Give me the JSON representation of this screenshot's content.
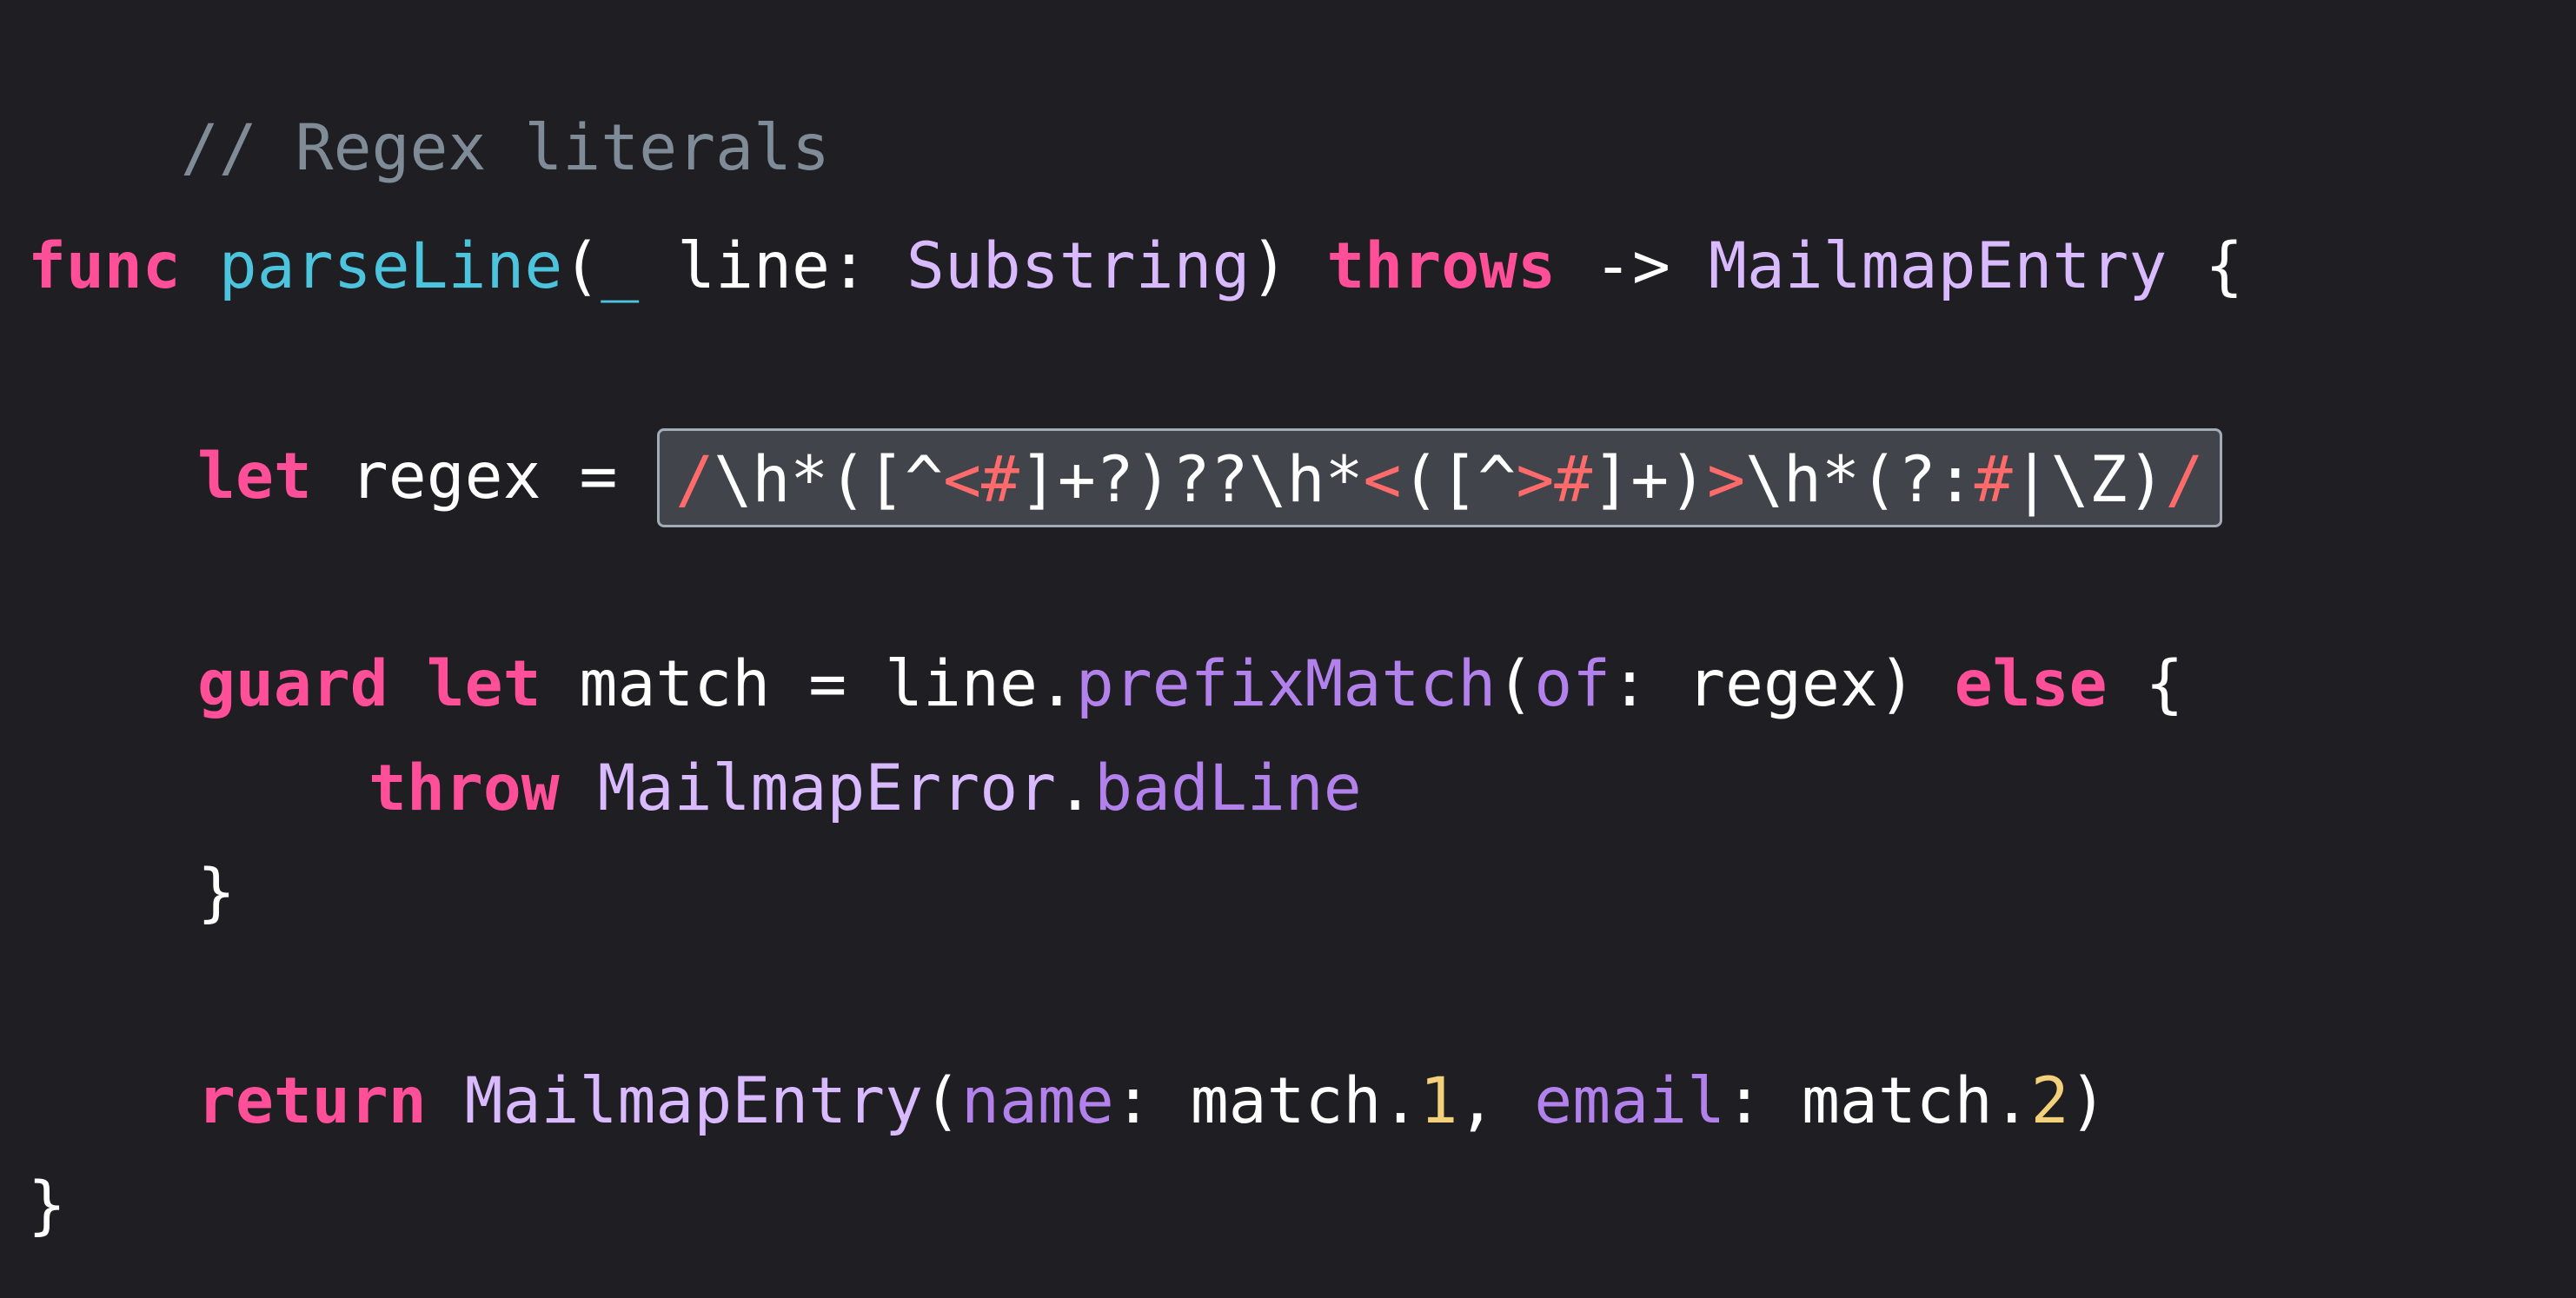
{
  "editor": {
    "lines": {
      "comment": "// Regex literals",
      "signature": {
        "kw_func": "func",
        "fn_name": "parseLine",
        "open_paren": "(",
        "underscore": "_",
        "param": " line: ",
        "param_type": "Substring",
        "close_paren": ") ",
        "kw_throws": "throws",
        "arrow": " -> ",
        "return_type": "MailmapEntry",
        "open_brace": " {"
      },
      "let_line": {
        "kw_let": "let",
        "rest": " regex = ",
        "regex": [
          {
            "text": "/",
            "kind": "delim"
          },
          {
            "text": "\\h*([^",
            "kind": "regex"
          },
          {
            "text": "<#",
            "kind": "delim"
          },
          {
            "text": "]+?)??\\h*",
            "kind": "regex"
          },
          {
            "text": "<",
            "kind": "delim"
          },
          {
            "text": "([^",
            "kind": "regex"
          },
          {
            "text": ">#",
            "kind": "delim"
          },
          {
            "text": "]+)",
            "kind": "regex"
          },
          {
            "text": ">",
            "kind": "delim"
          },
          {
            "text": "\\h*(?:",
            "kind": "regex"
          },
          {
            "text": "#",
            "kind": "delim"
          },
          {
            "text": "|\\Z)",
            "kind": "regex"
          },
          {
            "text": "/",
            "kind": "delim"
          }
        ]
      },
      "guard_line": {
        "kw_guard": "guard",
        "kw_let": "let",
        "part1": " match = line.",
        "method": "prefixMatch",
        "open_paren": "(",
        "label": "of",
        "part2": ": regex) ",
        "kw_else": "else",
        "open_brace": " {"
      },
      "throw_line": {
        "kw_throw": "throw",
        "type": "MailmapError",
        "dot": ".",
        "member": "badLine"
      },
      "guard_close": "}",
      "return_line": {
        "kw_return": "return",
        "type": "MailmapEntry",
        "open_paren": "(",
        "label_name": "name",
        "part1": ": match.",
        "num1": "1",
        "comma": ", ",
        "label_email": "email",
        "part2": ": match.",
        "num2": "2",
        "close_paren": ")"
      },
      "func_close": "}"
    }
  },
  "colors": {
    "background": "#1f1f23",
    "keyword": "#ff4f98",
    "function_name": "#4cc4dd",
    "type_name": "#dabaff",
    "member": "#b281eb",
    "comment": "#7f8c98",
    "number": "#f3d17a",
    "regex_delimiter": "#ff6b6b",
    "regex_highlight_bg": "#41444b",
    "regex_highlight_border": "#a3acb6"
  }
}
